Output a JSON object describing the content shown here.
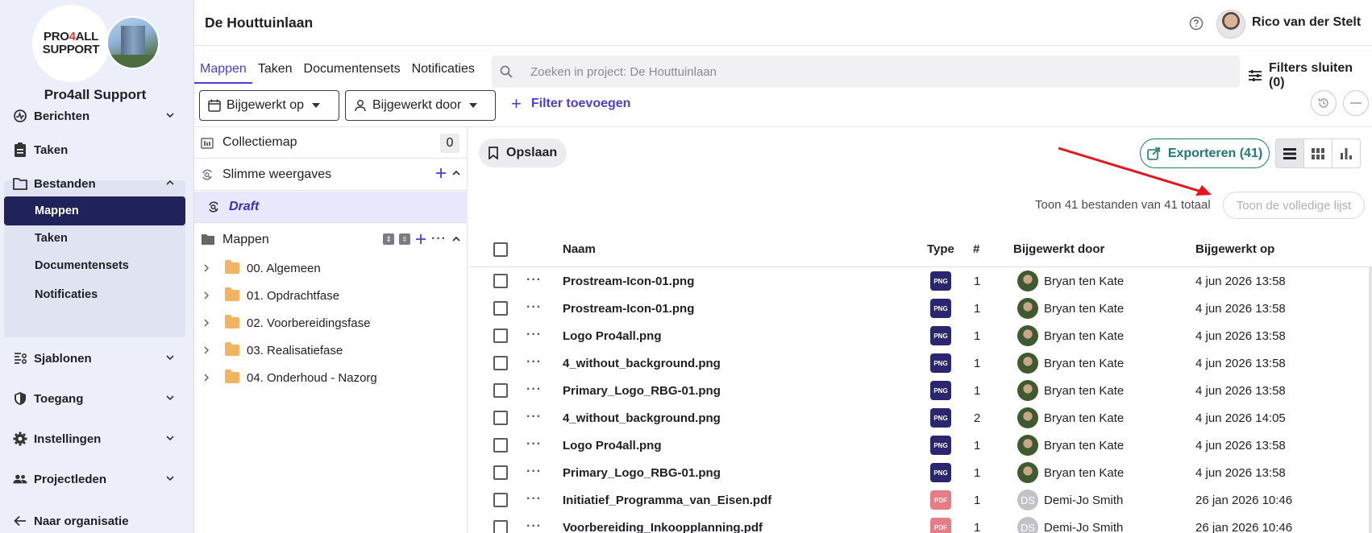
{
  "sidebar": {
    "logo_line1": "PRO4ALL",
    "logo_pre": "PRO",
    "logo_four": "4",
    "logo_post": "ALL",
    "logo_line2": "SUPPORT",
    "org_name": "Pro4all Support",
    "items": [
      {
        "label": "Berichten",
        "icon": "activity-icon",
        "chevron": "chevron-down-icon"
      },
      {
        "label": "Taken",
        "icon": "clipboard-icon"
      },
      {
        "label": "Bestanden",
        "icon": "folder-icon",
        "chevron": "chevron-up-icon"
      },
      {
        "label": "Sjablonen",
        "icon": "templates-icon",
        "chevron": "chevron-down-icon"
      },
      {
        "label": "Toegang",
        "icon": "shield-icon",
        "chevron": "chevron-down-icon"
      },
      {
        "label": "Instellingen",
        "icon": "gear-icon",
        "chevron": "chevron-down-icon"
      },
      {
        "label": "Projectleden",
        "icon": "people-icon",
        "chevron": "chevron-down-icon"
      },
      {
        "label": "Naar organisatie",
        "icon": "arrow-left-icon"
      }
    ],
    "bestanden_sub": [
      "Mappen",
      "Taken",
      "Documentensets",
      "Notificaties"
    ]
  },
  "header": {
    "project_title": "De Houttuinlaan",
    "user_name": "Rico van der Stelt"
  },
  "tabs": [
    "Mappen",
    "Taken",
    "Documentensets",
    "Notificaties"
  ],
  "search": {
    "placeholder": "Zoeken in project: De Houttuinlaan"
  },
  "filters_close": "Filters sluiten (0)",
  "filter_bar": {
    "updated_on": "Bijgewerkt op",
    "updated_by": "Bijgewerkt door",
    "add_filter": "Filter toevoegen"
  },
  "folder_panel": {
    "collection": {
      "label": "Collectiemap",
      "count": "0"
    },
    "smart_views": "Slimme weergaves",
    "draft": "Draft",
    "folders_label": "Mappen",
    "folders": [
      "00. Algemeen",
      "01. Opdrachtfase",
      "02. Voorbereidingsfase",
      "03. Realisatiefase",
      "04. Onderhoud - Nazorg"
    ]
  },
  "toolbar": {
    "save": "Opslaan",
    "export": "Exporteren (41)",
    "showing": "Toon 41 bestanden van 41 totaal",
    "show_full": "Toon de volledige lijst"
  },
  "table": {
    "headers": {
      "name": "Naam",
      "type": "Type",
      "version": "#",
      "updated_by": "Bijgewerkt door",
      "updated_on": "Bijgewerkt op"
    },
    "rows": [
      {
        "name": "Prostream-Icon-01.png",
        "type": "PNG",
        "version": "1",
        "by": "Bryan ten Kate",
        "on": "4 jun 2026 13:58",
        "avatar": "photo"
      },
      {
        "name": "Prostream-Icon-01.png",
        "type": "PNG",
        "version": "1",
        "by": "Bryan ten Kate",
        "on": "4 jun 2026 13:58",
        "avatar": "photo"
      },
      {
        "name": "Logo Pro4all.png",
        "type": "PNG",
        "version": "1",
        "by": "Bryan ten Kate",
        "on": "4 jun 2026 13:58",
        "avatar": "photo"
      },
      {
        "name": "4_without_background.png",
        "type": "PNG",
        "version": "1",
        "by": "Bryan ten Kate",
        "on": "4 jun 2026 13:58",
        "avatar": "photo"
      },
      {
        "name": "Primary_Logo_RBG-01.png",
        "type": "PNG",
        "version": "1",
        "by": "Bryan ten Kate",
        "on": "4 jun 2026 13:58",
        "avatar": "photo"
      },
      {
        "name": "4_without_background.png",
        "type": "PNG",
        "version": "2",
        "by": "Bryan ten Kate",
        "on": "4 jun 2026 14:05",
        "avatar": "photo"
      },
      {
        "name": "Logo Pro4all.png",
        "type": "PNG",
        "version": "1",
        "by": "Bryan ten Kate",
        "on": "4 jun 2026 13:58",
        "avatar": "photo"
      },
      {
        "name": "Primary_Logo_RBG-01.png",
        "type": "PNG",
        "version": "1",
        "by": "Bryan ten Kate",
        "on": "4 jun 2026 13:58",
        "avatar": "photo"
      },
      {
        "name": "Initiatief_Programma_van_Eisen.pdf",
        "type": "PDF",
        "version": "1",
        "by": "Demi-Jo Smith",
        "on": "26 jan 2026 10:46",
        "avatar": "DS"
      },
      {
        "name": "Voorbereiding_Inkoopplanning.pdf",
        "type": "PDF",
        "version": "1",
        "by": "Demi-Jo Smith",
        "on": "26 jan 2026 10:46",
        "avatar": "DS"
      }
    ]
  },
  "colors": {
    "accent": "#4b3ed6",
    "nav_active": "#20235a",
    "export": "#1d7a6e",
    "png_badge": "#2a2770",
    "pdf_badge": "#e57c86",
    "annotation_arrow": "#e8131b"
  }
}
